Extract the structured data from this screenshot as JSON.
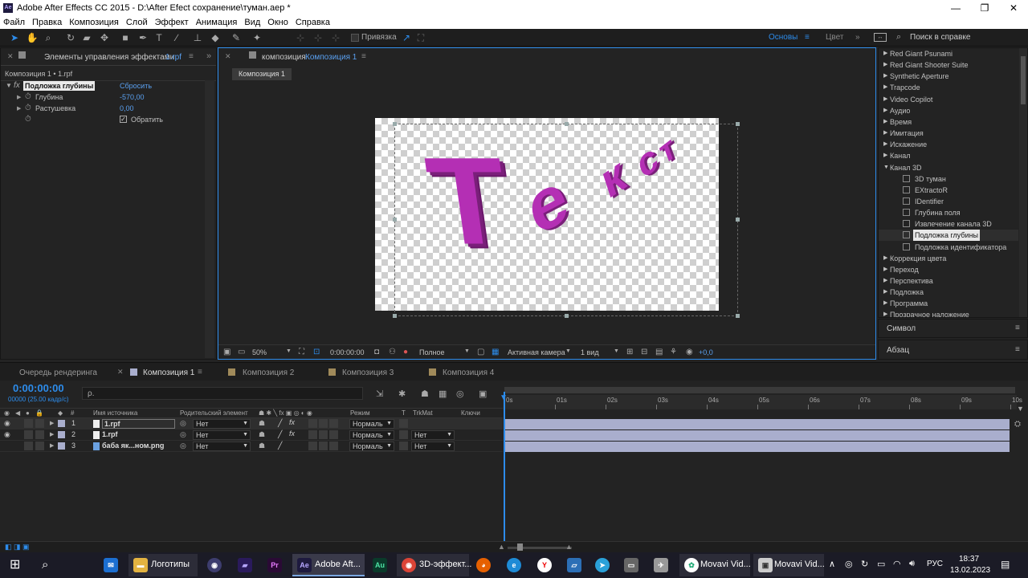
{
  "window": {
    "title": "Adobe After Effects CC 2015 - D:\\After Efect сохранение\\туман.aep *",
    "app_icon": "Ae"
  },
  "menu": [
    "Файл",
    "Правка",
    "Композиция",
    "Слой",
    "Эффект",
    "Анимация",
    "Вид",
    "Окно",
    "Справка"
  ],
  "toolbar": {
    "snap_label": "Привязка",
    "workspace_active": "Основы",
    "workspace_other": "Цвет",
    "help_placeholder": "Поиск в справке"
  },
  "effects_panel": {
    "tab_prefix": "Элементы управления эффектами",
    "tab_file": "1.rpf",
    "breadcrumb": "Композиция 1 • 1.rpf",
    "effect_name": "Подложка глубины",
    "reset_label": "Сбросить",
    "props": [
      {
        "name": "Глубина",
        "value": "-570,00"
      },
      {
        "name": "Растушевка",
        "value": "0,00"
      }
    ],
    "invert_label": "Обратить"
  },
  "comp_panel": {
    "tab_prefix": "композиция",
    "tab_name": "Композиция 1",
    "sub_tab": "Композиция 1",
    "preview_text": "Текст",
    "footer": {
      "zoom": "50%",
      "timecode": "0:00:00:00",
      "quality": "Полное",
      "camera": "Активная камера",
      "views": "1 вид",
      "exposure": "+0,0"
    }
  },
  "effects_list": {
    "items": [
      {
        "label": "Red Giant Psunami",
        "type": "cat"
      },
      {
        "label": "Red Giant Shooter Suite",
        "type": "cat"
      },
      {
        "label": "Synthetic Aperture",
        "type": "cat"
      },
      {
        "label": "Trapcode",
        "type": "cat"
      },
      {
        "label": "Video Copilot",
        "type": "cat"
      },
      {
        "label": "Аудио",
        "type": "cat"
      },
      {
        "label": "Время",
        "type": "cat"
      },
      {
        "label": "Имитация",
        "type": "cat"
      },
      {
        "label": "Искажение",
        "type": "cat"
      },
      {
        "label": "Канал",
        "type": "cat"
      },
      {
        "label": "Канал 3D",
        "type": "open"
      },
      {
        "label": "3D туман",
        "type": "fx"
      },
      {
        "label": "EXtractoR",
        "type": "fx"
      },
      {
        "label": "IDentifier",
        "type": "fx"
      },
      {
        "label": "Глубина поля",
        "type": "fx"
      },
      {
        "label": "Извлечение канала 3D",
        "type": "fx"
      },
      {
        "label": "Подложка глубины",
        "type": "fx-selected"
      },
      {
        "label": "Подложка идентификатора",
        "type": "fx"
      },
      {
        "label": "Коррекция цвета",
        "type": "cat"
      },
      {
        "label": "Переход",
        "type": "cat"
      },
      {
        "label": "Перспектива",
        "type": "cat"
      },
      {
        "label": "Подложка",
        "type": "cat"
      },
      {
        "label": "Программа",
        "type": "cat"
      },
      {
        "label": "Прозрачное наложение",
        "type": "cat"
      }
    ],
    "char_panel": "Символ",
    "para_panel": "Абзац"
  },
  "timeline": {
    "tabs": [
      "Очередь рендеринга",
      "Композиция 1",
      "Композиция 2",
      "Композиция 3",
      "Композиция 4"
    ],
    "timecode": "0:00:00:00",
    "fps": "00000 (25.00 кадр/с)",
    "search_placeholder": "ρ.",
    "headers": {
      "num": "#",
      "source": "Имя источника",
      "parent": "Родительский элемент",
      "mode": "Режим",
      "t": "T",
      "trkmat": "TrkMat",
      "keys": "Ключи"
    },
    "layers": [
      {
        "num": "1",
        "name": "1.rpf",
        "parent": "Нет",
        "mode": "Нормаль",
        "trkmat": ""
      },
      {
        "num": "2",
        "name": "1.rpf",
        "parent": "Нет",
        "mode": "Нормаль",
        "trkmat": "Нет"
      },
      {
        "num": "3",
        "name": "баба як...ном.png",
        "parent": "Нет",
        "mode": "Нормаль",
        "trkmat": "Нет"
      }
    ],
    "ruler": [
      "0s",
      "01s",
      "02s",
      "03s",
      "04s",
      "05s",
      "06s",
      "07s",
      "08s",
      "09s",
      "10s"
    ]
  },
  "taskbar": {
    "folder_label": "Логотипы",
    "ae_label": "Adobe Aft...",
    "chrome_label": "3D-эффект...",
    "movavi1_label": "Movavi Vid...",
    "movavi2_label": "Movavi Vid...",
    "lang": "РУС",
    "time": "18:37",
    "date": "13.02.2023"
  },
  "colors": {
    "accent": "#2d8ceb",
    "text_magenta": "#b42fb4",
    "panel_bg": "#232323",
    "layer_bar": "#a9aecd"
  }
}
